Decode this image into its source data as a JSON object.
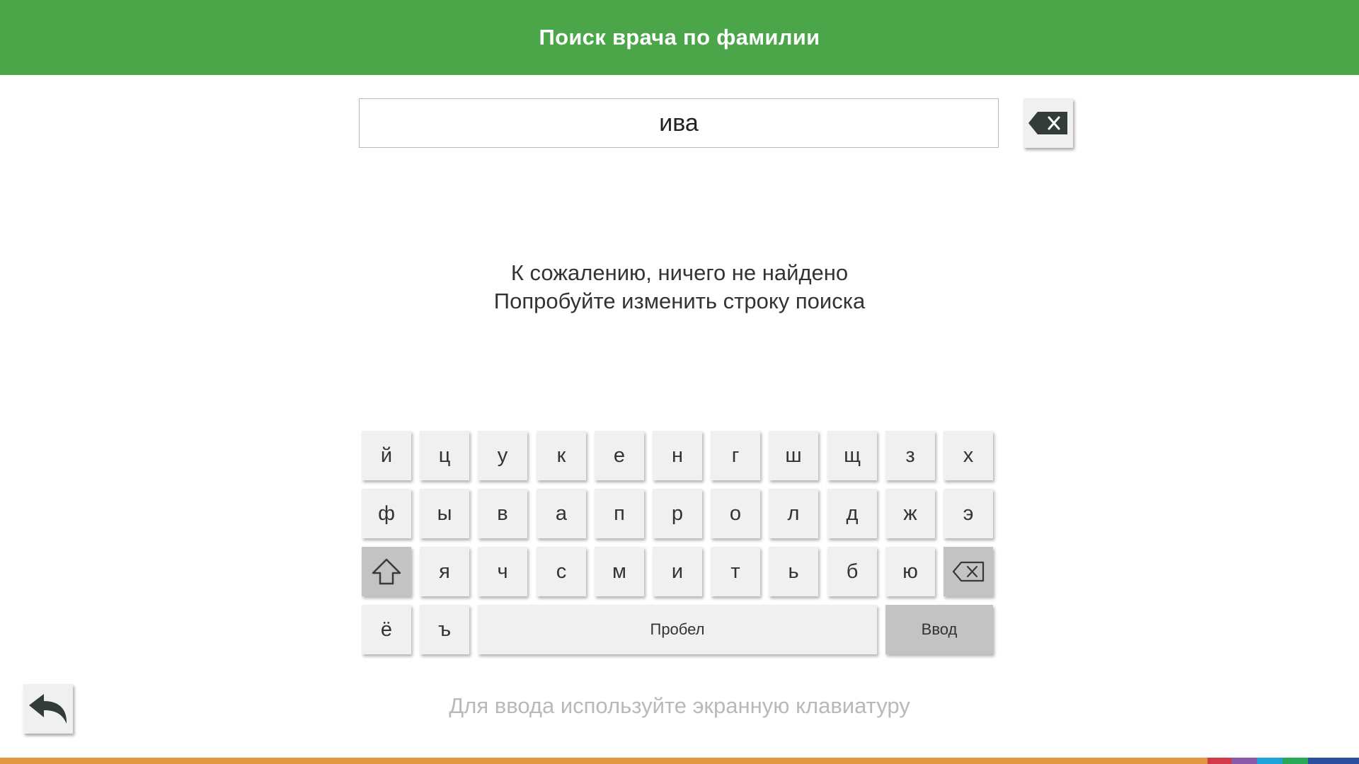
{
  "header": {
    "title": "Поиск врача по фамилии"
  },
  "search": {
    "value": "ива",
    "clear_icon": "backspace-x-icon"
  },
  "message": {
    "line1": "К сожалению, ничего не найдено",
    "line2": "Попробуйте изменить строку поиска"
  },
  "keyboard": {
    "row1": [
      "й",
      "ц",
      "у",
      "к",
      "е",
      "н",
      "г",
      "ш",
      "щ",
      "з",
      "х"
    ],
    "row2": [
      "ф",
      "ы",
      "в",
      "а",
      "п",
      "р",
      "о",
      "л",
      "д",
      "ж",
      "э"
    ],
    "row3": [
      "я",
      "ч",
      "с",
      "м",
      "и",
      "т",
      "ь",
      "б",
      "ю"
    ],
    "row4": [
      "ё",
      "ъ"
    ],
    "shift_icon": "shift-arrow-icon",
    "backspace_icon": "backspace-icon",
    "space_label": "Пробел",
    "enter_label": "Ввод"
  },
  "hint": "Для ввода используйте экранную клавиатуру",
  "back_icon": "back-arrow-icon",
  "colors": {
    "header": "#4aa648",
    "key": "#f0f0f0",
    "key_dark": "#c3c3c3",
    "footer": [
      "#e0973f",
      "#d23a4a",
      "#8a5aa8",
      "#1ea3d8",
      "#2aa85a",
      "#2b4f9e"
    ]
  }
}
